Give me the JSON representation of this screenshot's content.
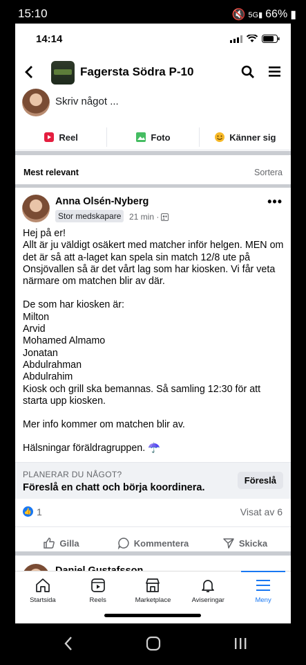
{
  "android_status": {
    "time": "15:10",
    "battery": "66%"
  },
  "ios_status": {
    "time": "14:14"
  },
  "header": {
    "group_name": "Fagersta Södra P-10"
  },
  "compose": {
    "placeholder": "Skriv något ..."
  },
  "compose_actions": [
    {
      "label": "Reel",
      "icon": "reel-icon",
      "color": "#e41e3f"
    },
    {
      "label": "Foto",
      "icon": "photo-icon",
      "color": "#45bd62"
    },
    {
      "label": "Känner sig",
      "icon": "smiley-icon",
      "color": "#f7b928"
    }
  ],
  "sort": {
    "label": "Mest relevant",
    "action": "Sortera"
  },
  "post": {
    "author": "Anna Olsén-Nyberg",
    "badge": "Stor medskapare",
    "time": "21 min ·",
    "body": [
      "Hej på er!\nAllt är ju väldigt osäkert med matcher inför helgen. MEN om det är så att a-laget kan spela sin match 12/8 ute på Onsjövallen så är det vårt lag som har kiosken. Vi får veta närmare om matchen blir av där.",
      "De som har kiosken är:\nMilton\nArvid\nMohamed Almamo\nJonatan\nAbdulrahman\nAbdulrahim\nKiosk och grill ska bemannas. Så samling 12:30 för att starta upp kiosken.",
      "Mer info kommer om matchen blir av.",
      "Hälsningar föräldragruppen. ☂️"
    ],
    "suggest": {
      "kicker": "PLANERAR DU NÅGOT?",
      "text": "Föreslå en chatt och börja koordinera.",
      "button": "Föreslå"
    },
    "reactions": {
      "count": "1",
      "seen": "Visat av 6"
    },
    "actions": [
      "Gilla",
      "Kommentera",
      "Skicka"
    ]
  },
  "next_post": {
    "author": "Daniel Gustafsson"
  },
  "tabs": [
    {
      "label": "Startsida",
      "icon": "home-icon"
    },
    {
      "label": "Reels",
      "icon": "reels-icon"
    },
    {
      "label": "Marketplace",
      "icon": "marketplace-icon"
    },
    {
      "label": "Aviseringar",
      "icon": "bell-icon"
    },
    {
      "label": "Meny",
      "icon": "menu-icon",
      "active": true
    }
  ]
}
